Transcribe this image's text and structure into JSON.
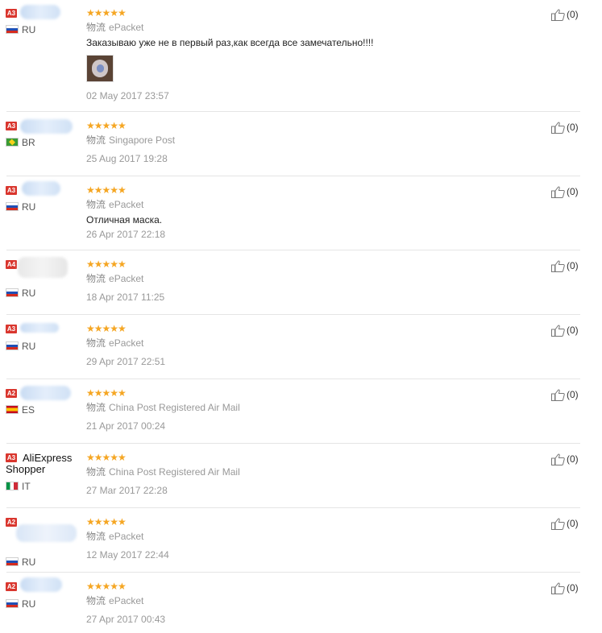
{
  "reviews": [
    {
      "level": "A3",
      "name": "",
      "country": "RU",
      "flag": "ru",
      "stars": "★★★★★",
      "logistics_label": "物流",
      "logistics": "ePacket",
      "comment": "Заказываю уже не в первый раз,как всегда все замечательно!!!!",
      "has_photo": true,
      "date": "02 May 2017 23:57",
      "useful": "(0)"
    },
    {
      "level": "A3",
      "name": "",
      "country": "BR",
      "flag": "br",
      "stars": "★★★★★",
      "logistics_label": "物流",
      "logistics": "Singapore Post",
      "comment": "",
      "date": "25 Aug 2017 19:28",
      "useful": "(0)"
    },
    {
      "level": "A3",
      "name": "",
      "country": "RU",
      "flag": "ru",
      "stars": "★★★★★",
      "logistics_label": "物流",
      "logistics": "ePacket",
      "comment": "Отличная маска.",
      "date": "26 Apr 2017 22:18",
      "useful": "(0)"
    },
    {
      "level": "A4",
      "name": "",
      "country": "RU",
      "flag": "ru",
      "stars": "★★★★★",
      "logistics_label": "物流",
      "logistics": "ePacket",
      "comment": "",
      "date": "18 Apr 2017 11:25",
      "useful": "(0)"
    },
    {
      "level": "A3",
      "name": "",
      "country": "RU",
      "flag": "ru",
      "stars": "★★★★★",
      "logistics_label": "物流",
      "logistics": "ePacket",
      "comment": "",
      "date": "29 Apr 2017 22:51",
      "useful": "(0)"
    },
    {
      "level": "A2",
      "name": "",
      "country": "ES",
      "flag": "es",
      "stars": "★★★★★",
      "logistics_label": "物流",
      "logistics": "China Post Registered Air Mail",
      "comment": "",
      "date": "21 Apr 2017 00:24",
      "useful": "(0)"
    },
    {
      "level": "A3",
      "name": "AliExpress Shopper",
      "country": "IT",
      "flag": "it",
      "stars": "★★★★★",
      "logistics_label": "物流",
      "logistics": "China Post Registered Air Mail",
      "comment": "",
      "date": "27 Mar 2017 22:28",
      "useful": "(0)"
    },
    {
      "level": "A2",
      "name": "",
      "country": "RU",
      "flag": "ru",
      "stars": "★★★★★",
      "logistics_label": "物流",
      "logistics": "ePacket",
      "comment": "",
      "date": "12 May 2017 22:44",
      "useful": "(0)"
    },
    {
      "level": "A2",
      "name": "",
      "country": "RU",
      "flag": "ru",
      "stars": "★★★★★",
      "logistics_label": "物流",
      "logistics": "ePacket",
      "comment": "",
      "date": "27 Apr 2017 00:43",
      "useful": "(0)"
    }
  ],
  "colors": {
    "star": "#f5a623",
    "level_badge": "#d9362e",
    "muted_text": "#999999",
    "divider": "#e5e5e5"
  },
  "icons": {
    "useful": "thumbs-up-icon",
    "star": "star-icon"
  }
}
